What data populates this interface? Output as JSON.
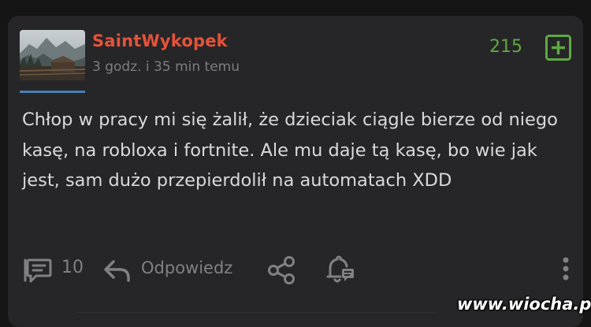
{
  "post": {
    "username": "SaintWykopek",
    "timestamp": "3 godz. i 35 min temu",
    "votes": "215",
    "content": "Chłop w pracy mi się żalił, że dzieciak ciągle bierze od niego kasę, na robloxa i fortnite. Ale mu daje tą kasę, bo wie jak jest, sam dużo przepierdolił na automatach XDD"
  },
  "actions": {
    "comment_count": "10",
    "reply_label": "Odpowiedz"
  },
  "watermark": "www.wiocha.pl",
  "icons": [
    "plus-icon",
    "comment-icon",
    "reply-arrow-icon",
    "share-icon",
    "bell-icon",
    "more-vertical-icon"
  ],
  "colors": {
    "background": "#151516",
    "card": "#262628",
    "username": "#e5533a",
    "votes": "#5fa843",
    "text": "#d9d9dc",
    "muted": "#808085"
  }
}
